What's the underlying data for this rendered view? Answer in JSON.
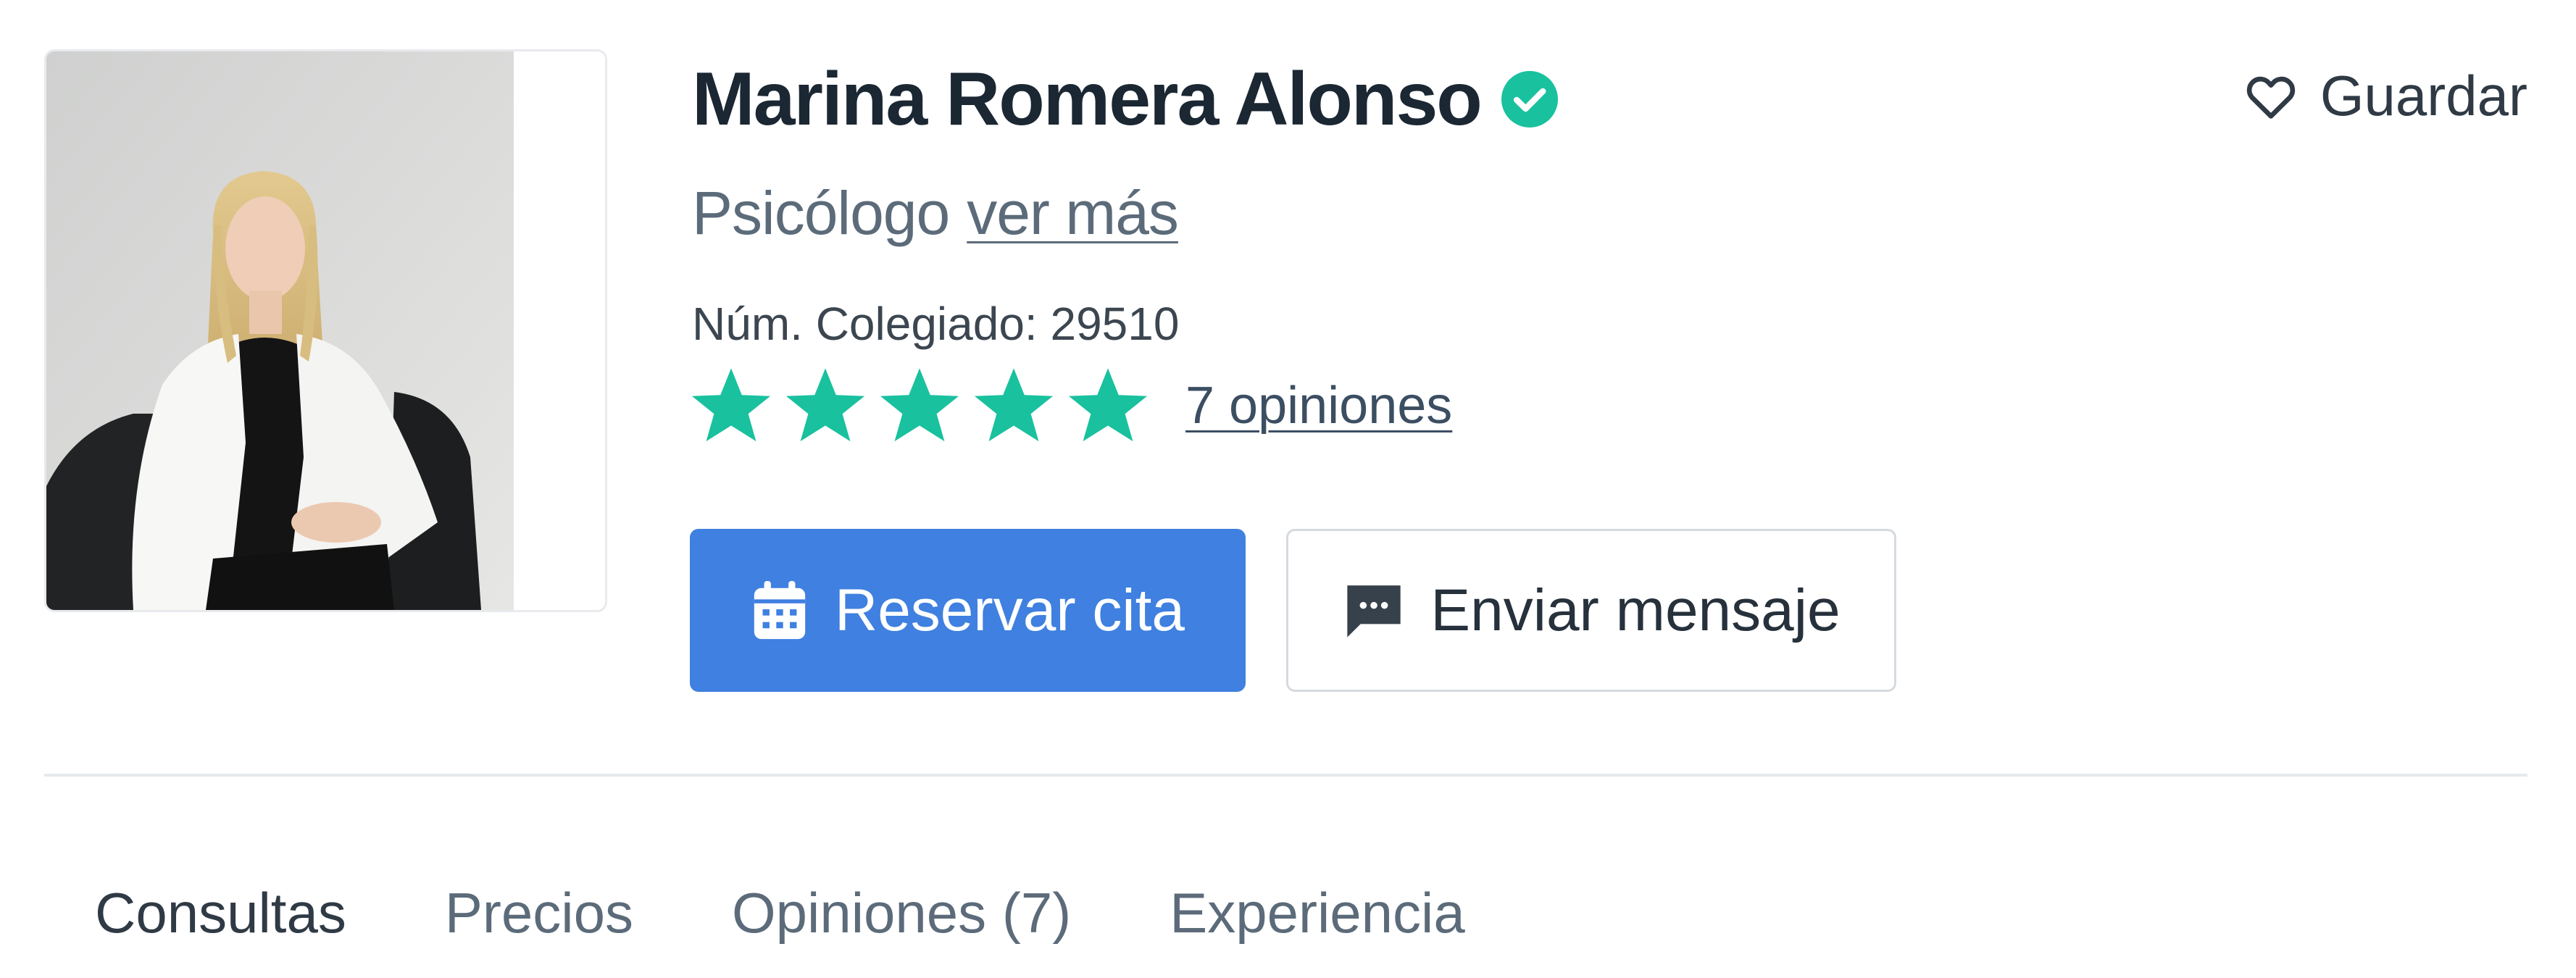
{
  "profile": {
    "name": "Marina Romera Alonso",
    "specialty": "Psicólogo",
    "see_more": "ver más",
    "license": "Núm. Colegiado: 29510",
    "rating": 5,
    "rating_max": 5,
    "reviews_link": "7 opiniones"
  },
  "actions": {
    "save_label": "Guardar",
    "book_label": "Reservar cita",
    "message_label": "Enviar mensaje"
  },
  "tabs": [
    {
      "label": "Consultas",
      "active": true
    },
    {
      "label": "Precios",
      "active": false
    },
    {
      "label": "Opiniones (7)",
      "active": false
    },
    {
      "label": "Experiencia",
      "active": false
    }
  ],
  "colors": {
    "primary": "#3f80e0",
    "verified": "#19c19e",
    "star": "#19c19e",
    "text_dark": "#1b2733",
    "text_muted": "#5c6b7a"
  },
  "icons": {
    "verified": "verified-check-icon",
    "save": "heart-icon",
    "book": "calendar-icon",
    "message": "chat-bubble-icon",
    "star": "star-icon"
  }
}
